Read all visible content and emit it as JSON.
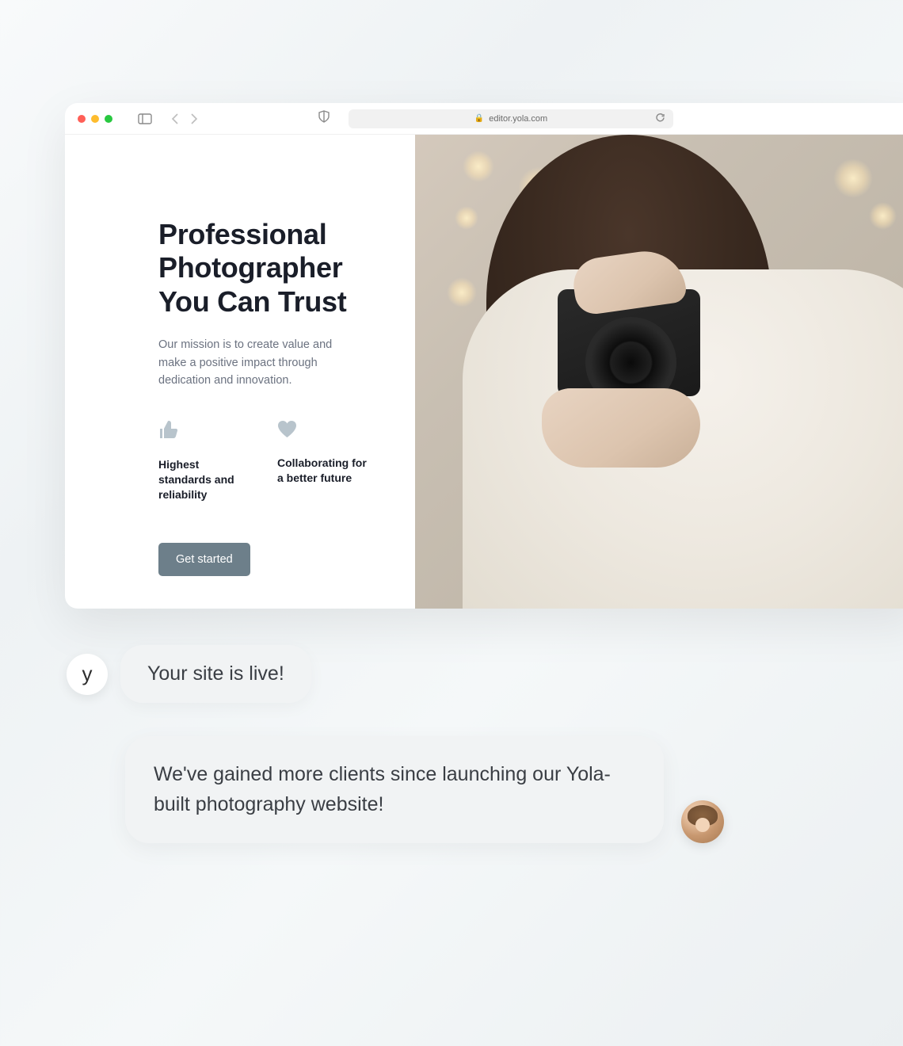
{
  "browser": {
    "url": "editor.yola.com"
  },
  "hero": {
    "title_line1": "Professional",
    "title_line2": "Photographer",
    "title_line3": "You Can Trust",
    "subtitle": "Our mission is to create value and make a positive impact through dedication and innovation.",
    "feature1": "Highest standards and reliability",
    "feature2": "Collaborating for a better future",
    "cta": "Get started"
  },
  "chat": {
    "yola_glyph": "y",
    "msg1": "Your site is live!",
    "msg2": "We've gained more clients since launching our Yola-built photography website!"
  }
}
